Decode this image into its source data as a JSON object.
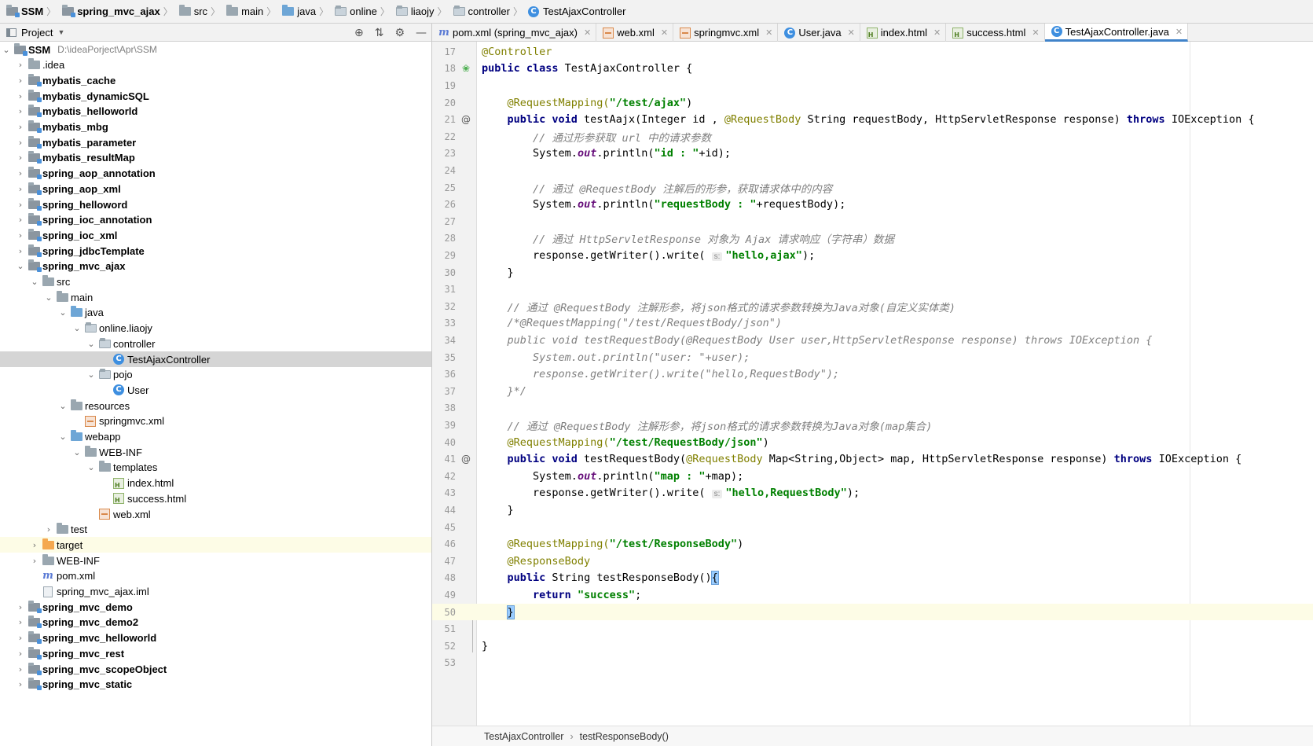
{
  "breadcrumbs": [
    "SSM",
    "spring_mvc_ajax",
    "src",
    "main",
    "java",
    "online",
    "liaojy",
    "controller",
    "TestAjaxController"
  ],
  "project_panel": {
    "title": "Project"
  },
  "tree": [
    {
      "label": "SSM",
      "path": "D:\\ideaPorject\\Apr\\SSM"
    },
    {
      "label": ".idea"
    },
    {
      "label": "mybatis_cache"
    },
    {
      "label": "mybatis_dynamicSQL"
    },
    {
      "label": "mybatis_helloworld"
    },
    {
      "label": "mybatis_mbg"
    },
    {
      "label": "mybatis_parameter"
    },
    {
      "label": "mybatis_resultMap"
    },
    {
      "label": "spring_aop_annotation"
    },
    {
      "label": "spring_aop_xml"
    },
    {
      "label": "spring_helloword"
    },
    {
      "label": "spring_ioc_annotation"
    },
    {
      "label": "spring_ioc_xml"
    },
    {
      "label": "spring_jdbcTemplate"
    },
    {
      "label": "spring_mvc_ajax"
    },
    {
      "label": "src"
    },
    {
      "label": "main"
    },
    {
      "label": "java"
    },
    {
      "label": "online.liaojy"
    },
    {
      "label": "controller"
    },
    {
      "label": "TestAjaxController"
    },
    {
      "label": "pojo"
    },
    {
      "label": "User"
    },
    {
      "label": "resources"
    },
    {
      "label": "springmvc.xml"
    },
    {
      "label": "webapp"
    },
    {
      "label": "WEB-INF"
    },
    {
      "label": "templates"
    },
    {
      "label": "index.html"
    },
    {
      "label": "success.html"
    },
    {
      "label": "web.xml"
    },
    {
      "label": "test"
    },
    {
      "label": "target"
    },
    {
      "label": "WEB-INF"
    },
    {
      "label": "pom.xml"
    },
    {
      "label": "spring_mvc_ajax.iml"
    },
    {
      "label": "spring_mvc_demo"
    },
    {
      "label": "spring_mvc_demo2"
    },
    {
      "label": "spring_mvc_helloworld"
    },
    {
      "label": "spring_mvc_rest"
    },
    {
      "label": "spring_mvc_scopeObject"
    },
    {
      "label": "spring_mvc_static"
    }
  ],
  "tabs": [
    {
      "label": "pom.xml (spring_mvc_ajax)",
      "icon": "maven-icon"
    },
    {
      "label": "web.xml",
      "icon": "xml-icon"
    },
    {
      "label": "springmvc.xml",
      "icon": "xml-icon"
    },
    {
      "label": "User.java",
      "icon": "class-icon"
    },
    {
      "label": "index.html",
      "icon": "html-icon"
    },
    {
      "label": "success.html",
      "icon": "html-icon"
    },
    {
      "label": "TestAjaxController.java",
      "icon": "class-icon",
      "active": true
    }
  ],
  "code": {
    "line_numbers": [
      "17",
      "18",
      "19",
      "20",
      "21",
      "22",
      "23",
      "24",
      "25",
      "26",
      "27",
      "28",
      "29",
      "30",
      "31",
      "32",
      "33",
      "34",
      "35",
      "36",
      "37",
      "38",
      "39",
      "40",
      "41",
      "42",
      "43",
      "44",
      "45",
      "46",
      "47",
      "48",
      "49",
      "50",
      "51",
      "52",
      "53"
    ],
    "l17_a": "@Controller",
    "l18_kw": "public class",
    "l18_rest": " TestAjaxController {",
    "l20_a": "@RequestMapping(",
    "l20_s": "\"/test/ajax\"",
    "l20_e": ")",
    "l21_kw": "public void",
    "l21_b": " testAajx(Integer id , ",
    "l21_an": "@RequestBody",
    "l21_c": " String requestBody, HttpServletResponse response) ",
    "l21_th": "throws",
    "l21_d": " IOException {",
    "l22_cm": "// 通过形参获取 url 中的请求参数",
    "l23_a": "System.",
    "l23_f": "out",
    "l23_b": ".println(",
    "l23_s": "\"id : \"",
    "l23_c": "+id);",
    "l25_cm": "// 通过 @RequestBody 注解后的形参，获取请求体中的内容",
    "l26_a": "System.",
    "l26_f": "out",
    "l26_b": ".println(",
    "l26_s": "\"requestBody : \"",
    "l26_c": "+requestBody);",
    "l28_cm": "// 通过 HttpServletResponse 对象为 Ajax 请求响应（字符串）数据",
    "l29_a": "response.getWriter().write( ",
    "l29_h": "s:",
    "l29_s": "\"hello,ajax\"",
    "l29_c": ");",
    "l30": "}",
    "l32_cm": "// 通过 @RequestBody 注解形参，将json格式的请求参数转换为Java对象(自定义实体类)",
    "l33_cm": "/*@RequestMapping(\"/test/RequestBody/json\")",
    "l34_cm": "public void testRequestBody(@RequestBody User user,HttpServletResponse response) throws IOException {",
    "l35_cm": "System.out.println(\"user: \"+user);",
    "l36_cm": "response.getWriter().write(\"hello,RequestBody\");",
    "l37_cm": "}*/",
    "l39_cm": "// 通过 @RequestBody 注解形参，将json格式的请求参数转换为Java对象(map集合)",
    "l40_a": "@RequestMapping(",
    "l40_s": "\"/test/RequestBody/json\"",
    "l40_e": ")",
    "l41_kw": "public void",
    "l41_b": " testRequestBody(",
    "l41_an": "@RequestBody",
    "l41_c": " Map<String,Object> map, HttpServletResponse response) ",
    "l41_th": "throws",
    "l41_d": " IOException {",
    "l42_a": "System.",
    "l42_f": "out",
    "l42_b": ".println(",
    "l42_s": "\"map : \"",
    "l42_c": "+map);",
    "l43_a": "response.getWriter().write( ",
    "l43_h": "s:",
    "l43_s": "\"hello,RequestBody\"",
    "l43_c": ");",
    "l44": "}",
    "l46_a": "@RequestMapping(",
    "l46_s": "\"/test/ResponseBody\"",
    "l46_e": ")",
    "l47_a": "@ResponseBody",
    "l48_kw": "public",
    "l48_b": " String testResponseBody()",
    "l48_br": "{",
    "l49_kw": "return",
    "l49_sp": " ",
    "l49_s": "\"success\"",
    "l49_c": ";",
    "l50_br": "}",
    "l52": "}"
  },
  "editor_breadcrumb": [
    "TestAjaxController",
    "testResponseBody()"
  ]
}
